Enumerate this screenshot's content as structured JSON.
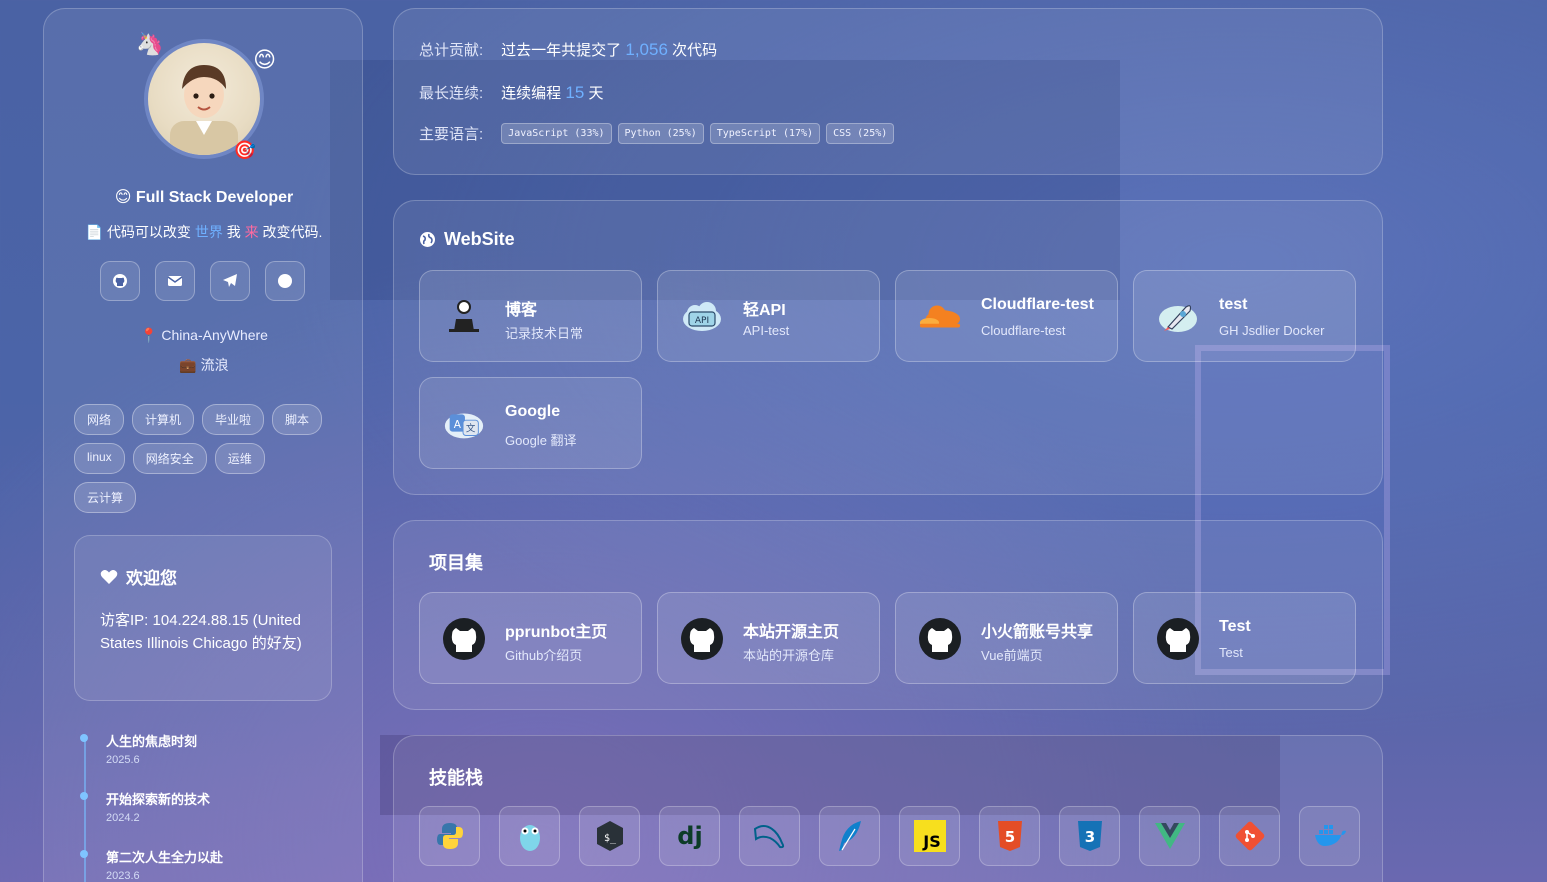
{
  "profile": {
    "role": "Full Stack Developer",
    "motto": {
      "prefix": "代码可以改变",
      "word1": "世界",
      "mid": "我",
      "word2": "来",
      "suffix": "改变代码."
    },
    "location": "China-AnyWhere",
    "job": "流浪",
    "tags": [
      "网络",
      "计算机",
      "毕业啦",
      "脚本",
      "linux",
      "网络安全",
      "运维",
      "云计算"
    ],
    "social_icons": [
      "github-icon",
      "mail-icon",
      "telegram-icon",
      "circle-icon"
    ]
  },
  "welcome": {
    "title": "欢迎您",
    "body": "访客IP: 104.224.88.15 (United States Illinois Chicago 的好友)"
  },
  "timeline": [
    {
      "title": "人生的焦虑时刻",
      "date": "2025.6"
    },
    {
      "title": "开始探索新的技术",
      "date": "2024.2"
    },
    {
      "title": "第二次人生全力以赴",
      "date": "2023.6"
    }
  ],
  "stats": {
    "total_label": "总计贡献:",
    "total_prefix": "过去一年共提交了",
    "total_value": "1,056",
    "total_suffix": "次代码",
    "streak_label": "最长连续:",
    "streak_prefix": "连续编程",
    "streak_value": "15",
    "streak_suffix": "天",
    "lang_label": "主要语言:",
    "languages": [
      "JavaScript (33%)",
      "Python (25%)",
      "TypeScript (17%)",
      "CSS (25%)"
    ]
  },
  "website": {
    "title": "WebSite",
    "cards": [
      {
        "title": "博客",
        "subtitle": "记录技术日常",
        "icon": "person-laptop-icon"
      },
      {
        "title": "轻API",
        "subtitle": "API-test",
        "icon": "api-cloud-icon"
      },
      {
        "title": "Cloudflare-test",
        "subtitle": "Cloudflare-test",
        "icon": "cloudflare-icon"
      },
      {
        "title": "test",
        "subtitle": "GH Jsdlier Docker",
        "icon": "rocket-icon"
      },
      {
        "title": "Google",
        "subtitle": "Google 翻译",
        "icon": "translate-icon"
      }
    ]
  },
  "projects": {
    "title": "项目集",
    "cards": [
      {
        "title": "pprunbot主页",
        "subtitle": "Github介绍页",
        "icon": "github-icon"
      },
      {
        "title": "本站开源主页",
        "subtitle": "本站的开源仓库",
        "icon": "github-icon"
      },
      {
        "title": "小火箭账号共享",
        "subtitle": "Vue前端页",
        "icon": "github-icon"
      },
      {
        "title": "Test",
        "subtitle": "Test",
        "icon": "github-icon"
      }
    ]
  },
  "skills": {
    "title": "技能栈",
    "items": [
      "python-icon",
      "go-icon",
      "bash-icon",
      "django-icon",
      "mysql-icon",
      "feather-icon",
      "javascript-icon",
      "html5-icon",
      "css3-icon",
      "vue-icon",
      "git-icon",
      "docker-icon"
    ]
  },
  "colors": {
    "accent_blue": "#6fb0ff",
    "accent_pink": "#ff6aa0"
  }
}
